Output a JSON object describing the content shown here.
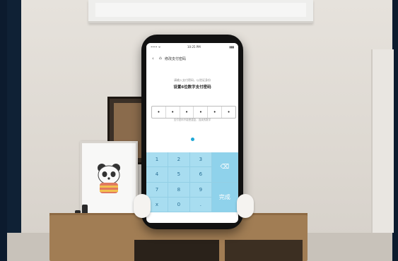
{
  "phone": {
    "status": {
      "left": "•••• ᯤ",
      "time": "10:25 PM",
      "right": "▮▮▮"
    },
    "appbar": {
      "title": "修改支付密码"
    },
    "hint_small": "请输入支付密码，以验证身份",
    "hint_main": "设置6位数字支付密码",
    "pin_dots": [
      "•",
      "•",
      "•",
      "•",
      "•",
      "•"
    ],
    "subhint": "支付密码不能是重复、连续的数字",
    "keypad": {
      "keys": [
        "1",
        "2",
        "3",
        "4",
        "5",
        "6",
        "7",
        "8",
        "9",
        "x",
        "0",
        "."
      ],
      "delete_icon": "⌫",
      "done_label": "完成"
    }
  }
}
